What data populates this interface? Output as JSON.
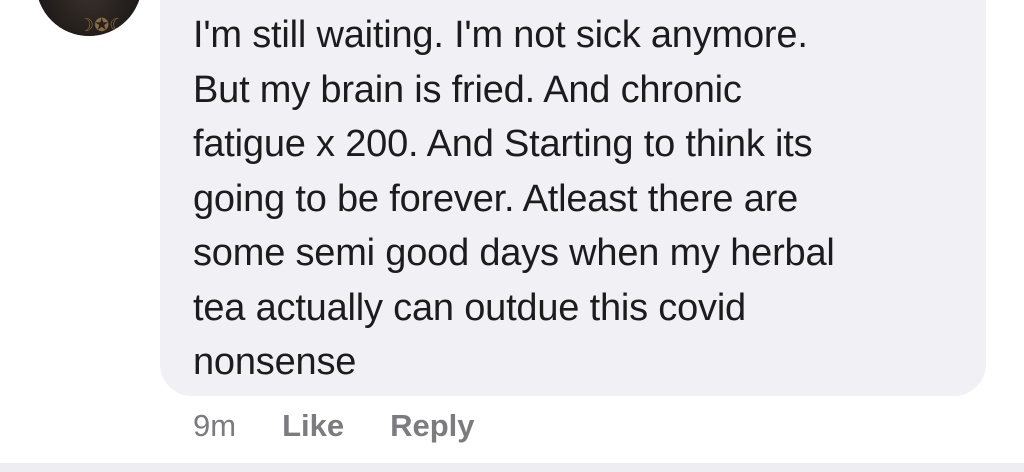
{
  "comment": {
    "author_avatar_icon": "avatar-icon",
    "text": "I'm still waiting. I'm not sick anymore.\nBut my brain is fried. And chronic\nfatigue x 200. And  Starting to think its\ngoing to be forever. Atleast there are\nsome semi good days when my herbal\ntea actually can outdue this covid\nnonsense",
    "timestamp": "9m",
    "like_label": "Like",
    "reply_label": "Reply"
  },
  "colors": {
    "bubble_bg": "#f0f0f5",
    "text": "#1c1c1e",
    "meta": "#7b7b80"
  }
}
